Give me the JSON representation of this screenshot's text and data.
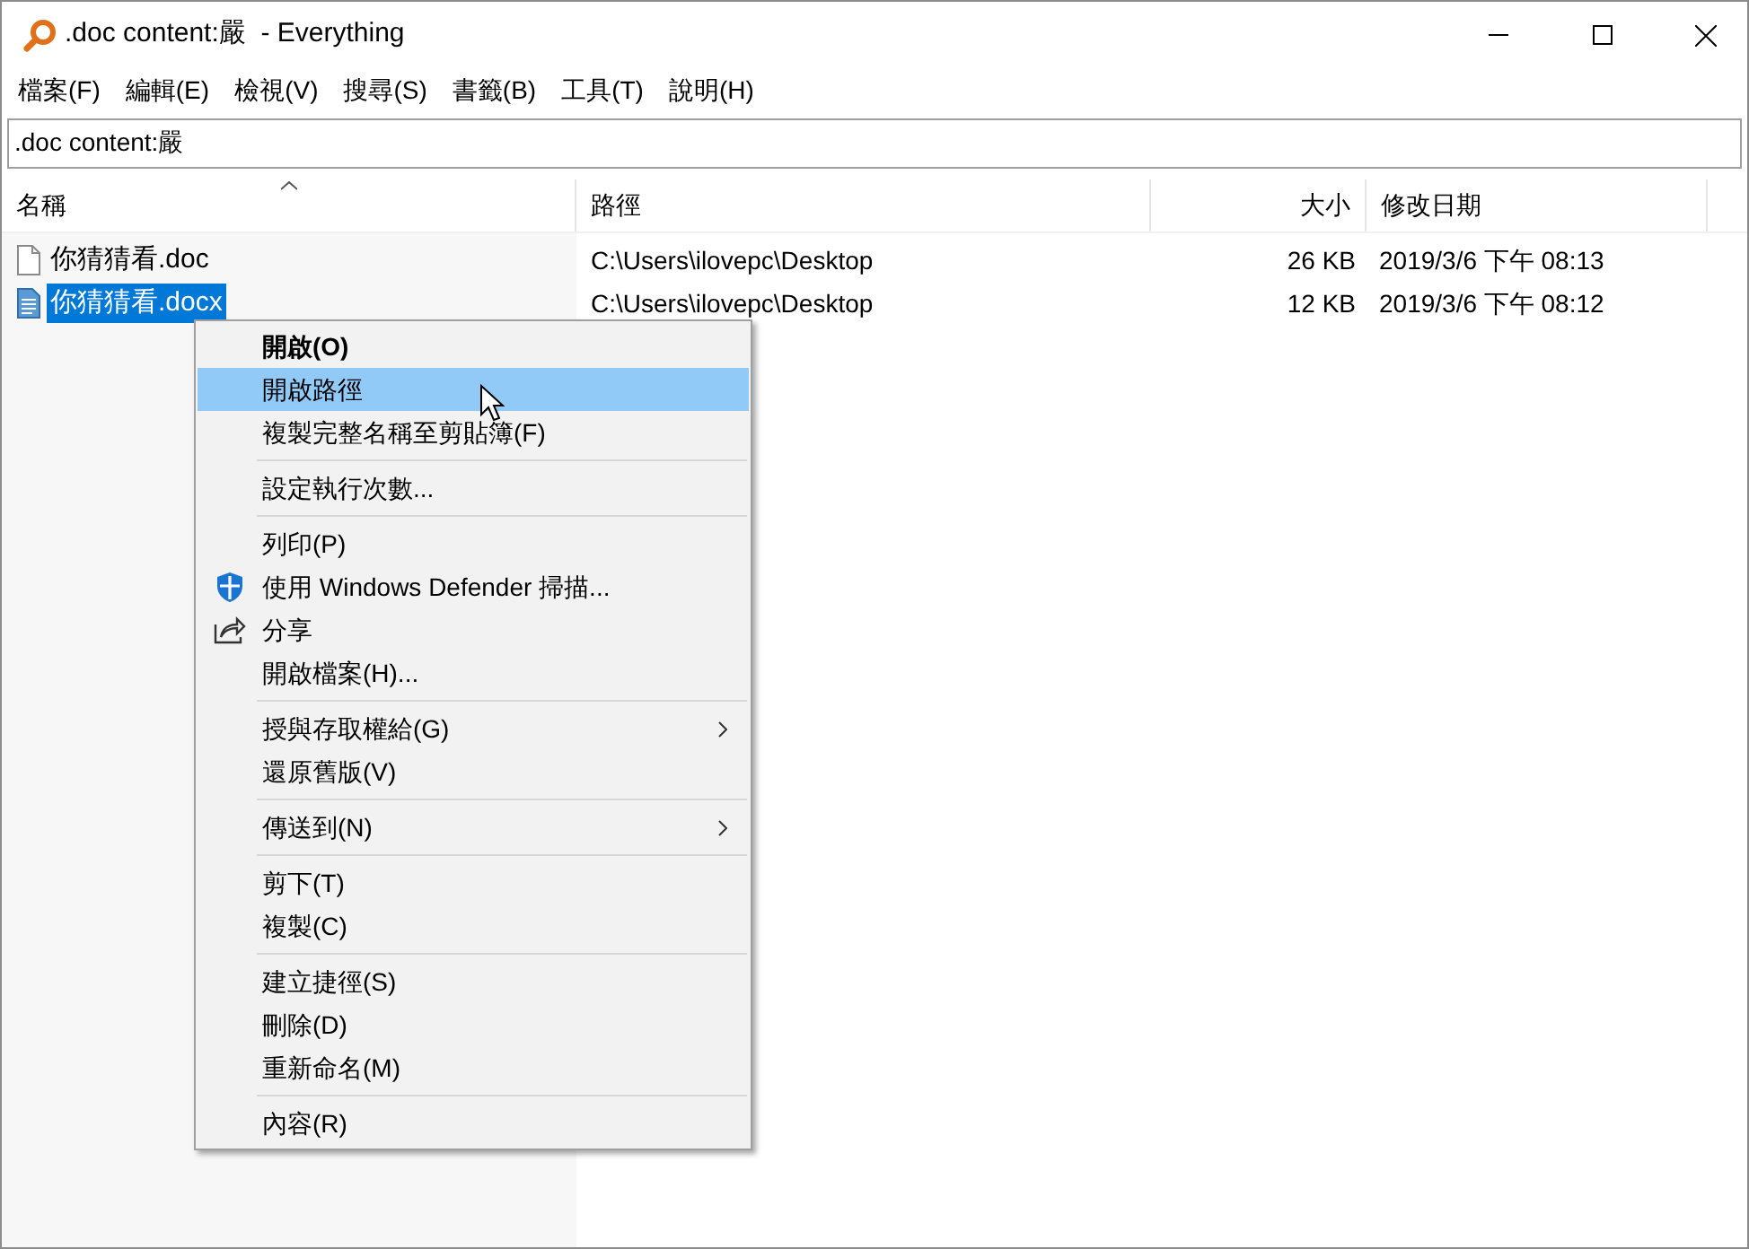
{
  "window": {
    "title": ".doc content:嚴  - Everything"
  },
  "menu_bar": [
    "檔案(F)",
    "編輯(E)",
    "檢視(V)",
    "搜尋(S)",
    "書籤(B)",
    "工具(T)",
    "說明(H)"
  ],
  "search": {
    "value": ".doc content:嚴"
  },
  "table": {
    "columns": [
      {
        "label": "名稱",
        "sorted": true
      },
      {
        "label": "路徑",
        "sorted": false
      },
      {
        "label": "大小",
        "sorted": false
      },
      {
        "label": "修改日期",
        "sorted": false
      }
    ],
    "rows": [
      {
        "kind": "doc",
        "name": "你猜猜看.doc",
        "path": "C:\\Users\\ilovepc\\Desktop",
        "size": "26 KB",
        "modified": "2019/3/6 下午 08:13",
        "selected": false
      },
      {
        "kind": "docx",
        "name": "你猜猜看.docx",
        "path": "C:\\Users\\ilovepc\\Desktop",
        "size": "12 KB",
        "modified": "2019/3/6 下午 08:12",
        "selected": true
      }
    ]
  },
  "context_menu": {
    "groups": [
      [
        {
          "label": "開啟(O)",
          "default": true,
          "selected": false
        },
        {
          "label": "開啟路徑",
          "selected": false,
          "hovered": true
        },
        {
          "label": "複製完整名稱至剪貼簿(F)",
          "selected": false
        }
      ],
      [
        {
          "label": "設定執行次數...",
          "selected": false
        }
      ],
      [
        {
          "label": "列印(P)",
          "selected": false
        },
        {
          "label": "使用 Windows Defender 掃描...",
          "kind": "shield",
          "selected": false
        },
        {
          "label": "分享",
          "kind": "share",
          "selected": false
        },
        {
          "label": "開啟檔案(H)...",
          "selected": false
        }
      ],
      [
        {
          "label": "授與存取權給(G)",
          "submenu": true,
          "selected": false
        },
        {
          "label": "還原舊版(V)",
          "selected": false
        }
      ],
      [
        {
          "label": "傳送到(N)",
          "submenu": true,
          "selected": false
        }
      ],
      [
        {
          "label": "剪下(T)",
          "selected": false
        },
        {
          "label": "複製(C)",
          "selected": false
        }
      ],
      [
        {
          "label": "建立捷徑(S)",
          "selected": false
        },
        {
          "label": "刪除(D)",
          "selected": false
        },
        {
          "label": "重新命名(M)",
          "selected": false
        }
      ],
      [
        {
          "label": "內容(R)",
          "selected": false
        }
      ]
    ]
  }
}
